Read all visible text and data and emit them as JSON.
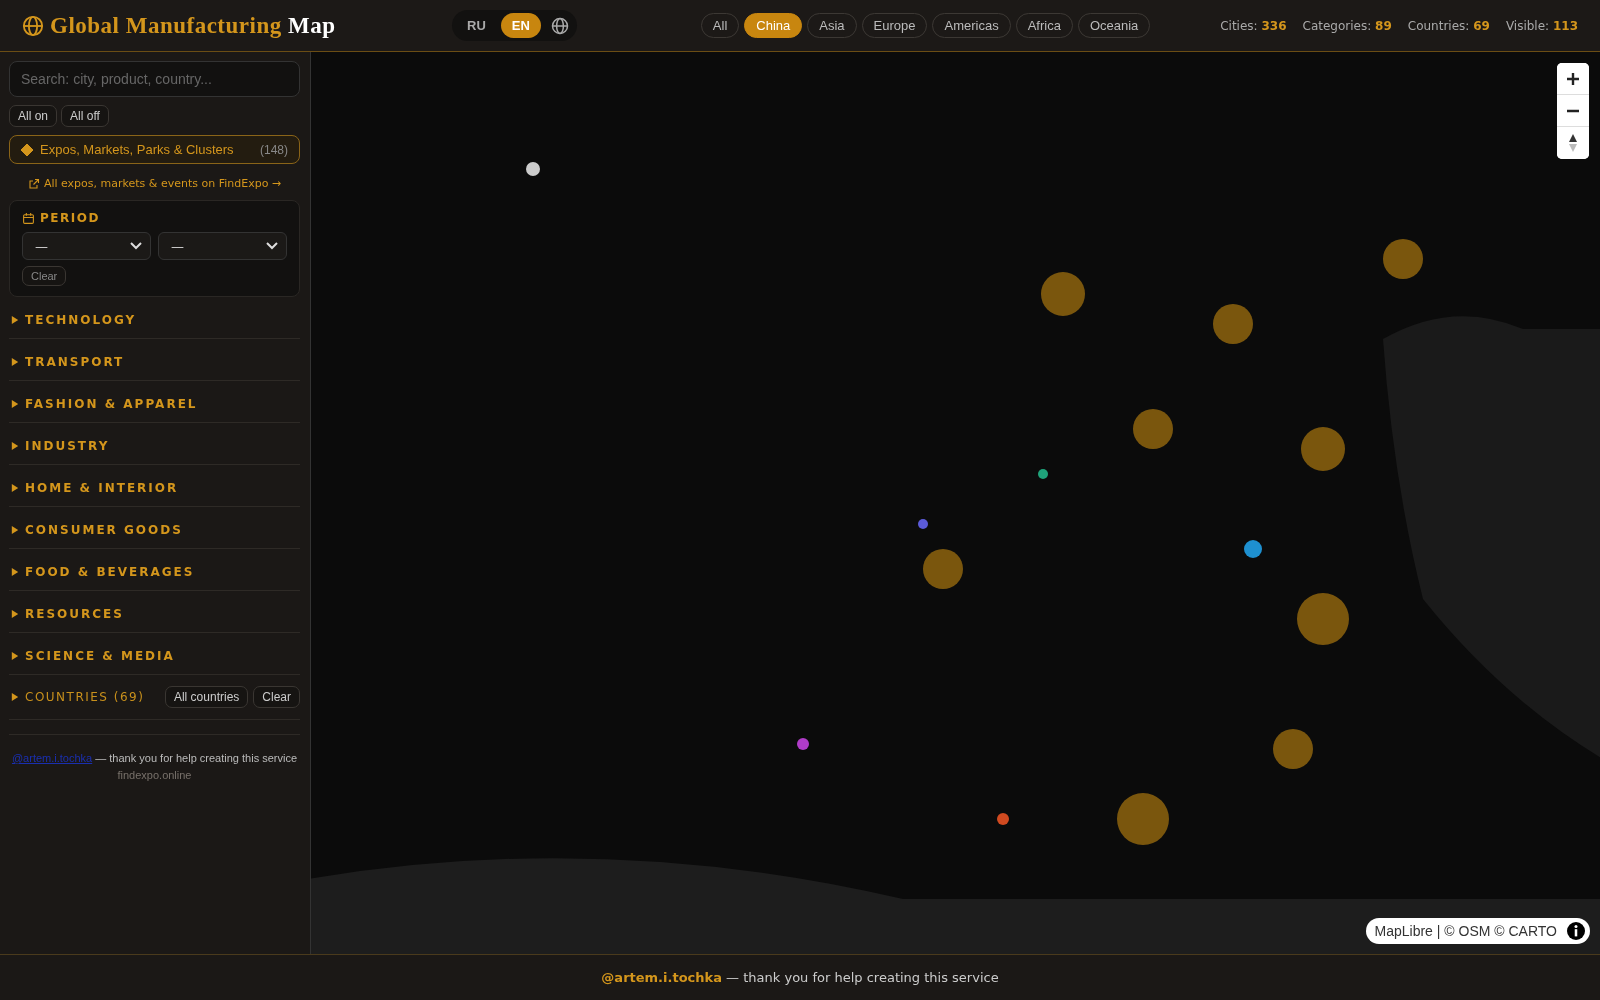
{
  "header": {
    "title": "Global Manufacturing",
    "title_accent": "Map"
  },
  "languages": [
    {
      "label": "RU",
      "selected": false
    },
    {
      "label": "EN",
      "selected": true
    }
  ],
  "regions": [
    {
      "label": "All",
      "selected": false
    },
    {
      "label": "China",
      "selected": true
    },
    {
      "label": "Asia",
      "selected": false
    },
    {
      "label": "Europe",
      "selected": false
    },
    {
      "label": "Americas",
      "selected": false
    },
    {
      "label": "Africa",
      "selected": false
    },
    {
      "label": "Oceania",
      "selected": false
    }
  ],
  "stats": [
    {
      "label": "Cities:",
      "value": "336"
    },
    {
      "label": "Categories:",
      "value": "89"
    },
    {
      "label": "Countries:",
      "value": "69"
    },
    {
      "label": "Visible:",
      "value": "113"
    }
  ],
  "sidebar": {
    "search": {
      "placeholder": "Search: city, product, country..."
    },
    "toggle_buttons": [
      "All on",
      "All off"
    ],
    "layer": {
      "label": "Expos, Markets, Parks & Clusters",
      "count": "(148)",
      "on": true
    },
    "link": "All expos, markets & events on FindExpo →",
    "period": {
      "title": "PERIOD",
      "from": "—",
      "to": "—",
      "clear": "Clear"
    },
    "categories": [
      {
        "label": "TECHNOLOGY",
        "expanded": false
      },
      {
        "label": "TRANSPORT",
        "expanded": false
      },
      {
        "label": "FASHION & APPAREL",
        "expanded": false
      },
      {
        "label": "INDUSTRY",
        "expanded": false
      },
      {
        "label": "HOME & INTERIOR",
        "expanded": false
      },
      {
        "label": "CONSUMER GOODS",
        "expanded": false
      },
      {
        "label": "FOOD & BEVERAGES",
        "expanded": false
      },
      {
        "label": "RESOURCES",
        "expanded": false
      },
      {
        "label": "SCIENCE & MEDIA",
        "expanded": false
      }
    ],
    "countries": {
      "label": "COUNTRIES (69)",
      "expanded": false,
      "buttons": [
        "All countries",
        "Clear"
      ]
    },
    "credit": {
      "link": "@artem.i.tochka",
      "text": "— thank you for help creating this service",
      "site": "findexpo.online"
    }
  },
  "map": {
    "kind": "picture",
    "attribution": "MapLibre | © OSM © CARTO"
  },
  "footer": {
    "link": "@artem.i.tochka",
    "text": "— thank you for help creating this service"
  }
}
